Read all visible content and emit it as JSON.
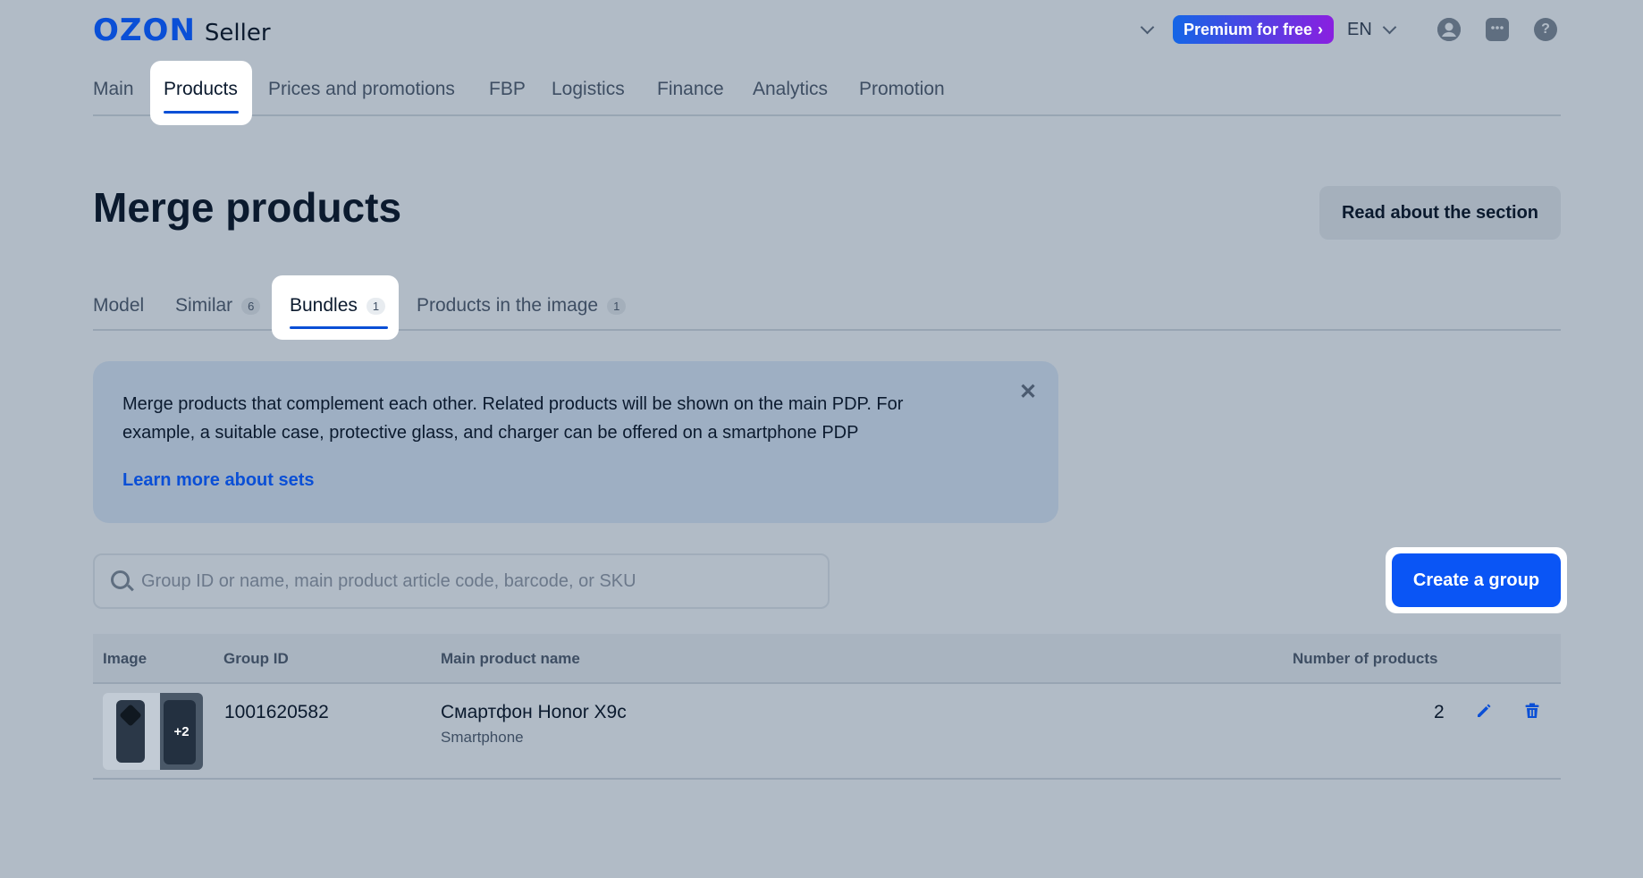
{
  "header": {
    "logo_brand": "OZON",
    "logo_product": "Seller",
    "premium_label": "Premium for free",
    "language": "EN",
    "icons": [
      "chevron-down-icon",
      "profile-icon",
      "chat-icon",
      "help-icon"
    ]
  },
  "nav": {
    "items": [
      {
        "label": "Main"
      },
      {
        "label": "Products"
      },
      {
        "label": "Prices and promotions"
      },
      {
        "label": "FBP"
      },
      {
        "label": "Logistics"
      },
      {
        "label": "Finance"
      },
      {
        "label": "Analytics"
      },
      {
        "label": "Promotion"
      }
    ],
    "active": "Products"
  },
  "page": {
    "title": "Merge products",
    "read_button": "Read about the section"
  },
  "tabs": {
    "items": [
      {
        "label": "Model",
        "count": ""
      },
      {
        "label": "Similar",
        "count": "6"
      },
      {
        "label": "Bundles",
        "count": "1"
      },
      {
        "label": "Products in the image",
        "count": "1"
      }
    ],
    "active": "Bundles"
  },
  "banner": {
    "text": "Merge products that complement each other. Related products will be shown on the main PDP. For example, a suitable case, protective glass, and charger can be offered on a smartphone PDP",
    "link": "Learn more about sets",
    "close": "✕"
  },
  "search": {
    "placeholder": "Group ID or name, main product article code, barcode, or SKU",
    "value": ""
  },
  "create_button": "Create a group",
  "table": {
    "headers": {
      "image": "Image",
      "group_id": "Group ID",
      "main_product": "Main product name",
      "count": "Number of products"
    },
    "rows": [
      {
        "extra_images": "+2",
        "group_id": "1001620582",
        "product_name": "Смартфон Honor X9c",
        "product_category": "Smartphone",
        "count": "2"
      }
    ]
  },
  "colors": {
    "accent": "#0a55f5",
    "link": "#0a4fd6",
    "premium_start": "#1466e6",
    "premium_end": "#8a1fe0"
  }
}
